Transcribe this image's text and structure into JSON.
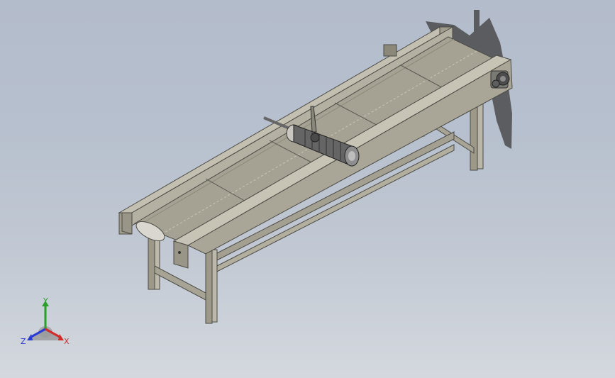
{
  "viewport": {
    "background_top": "#b3bccb",
    "background_bottom": "#d4d8de"
  },
  "model": {
    "part_color": "#a9a597",
    "belt_color": "#9f9b8e",
    "motor_color": "#6f6f6f"
  },
  "triad": {
    "x_label": "X",
    "y_label": "Y",
    "z_label": "Z",
    "x_color": "#d42a2a",
    "y_color": "#2aa02a",
    "z_color": "#2a3ad4"
  }
}
